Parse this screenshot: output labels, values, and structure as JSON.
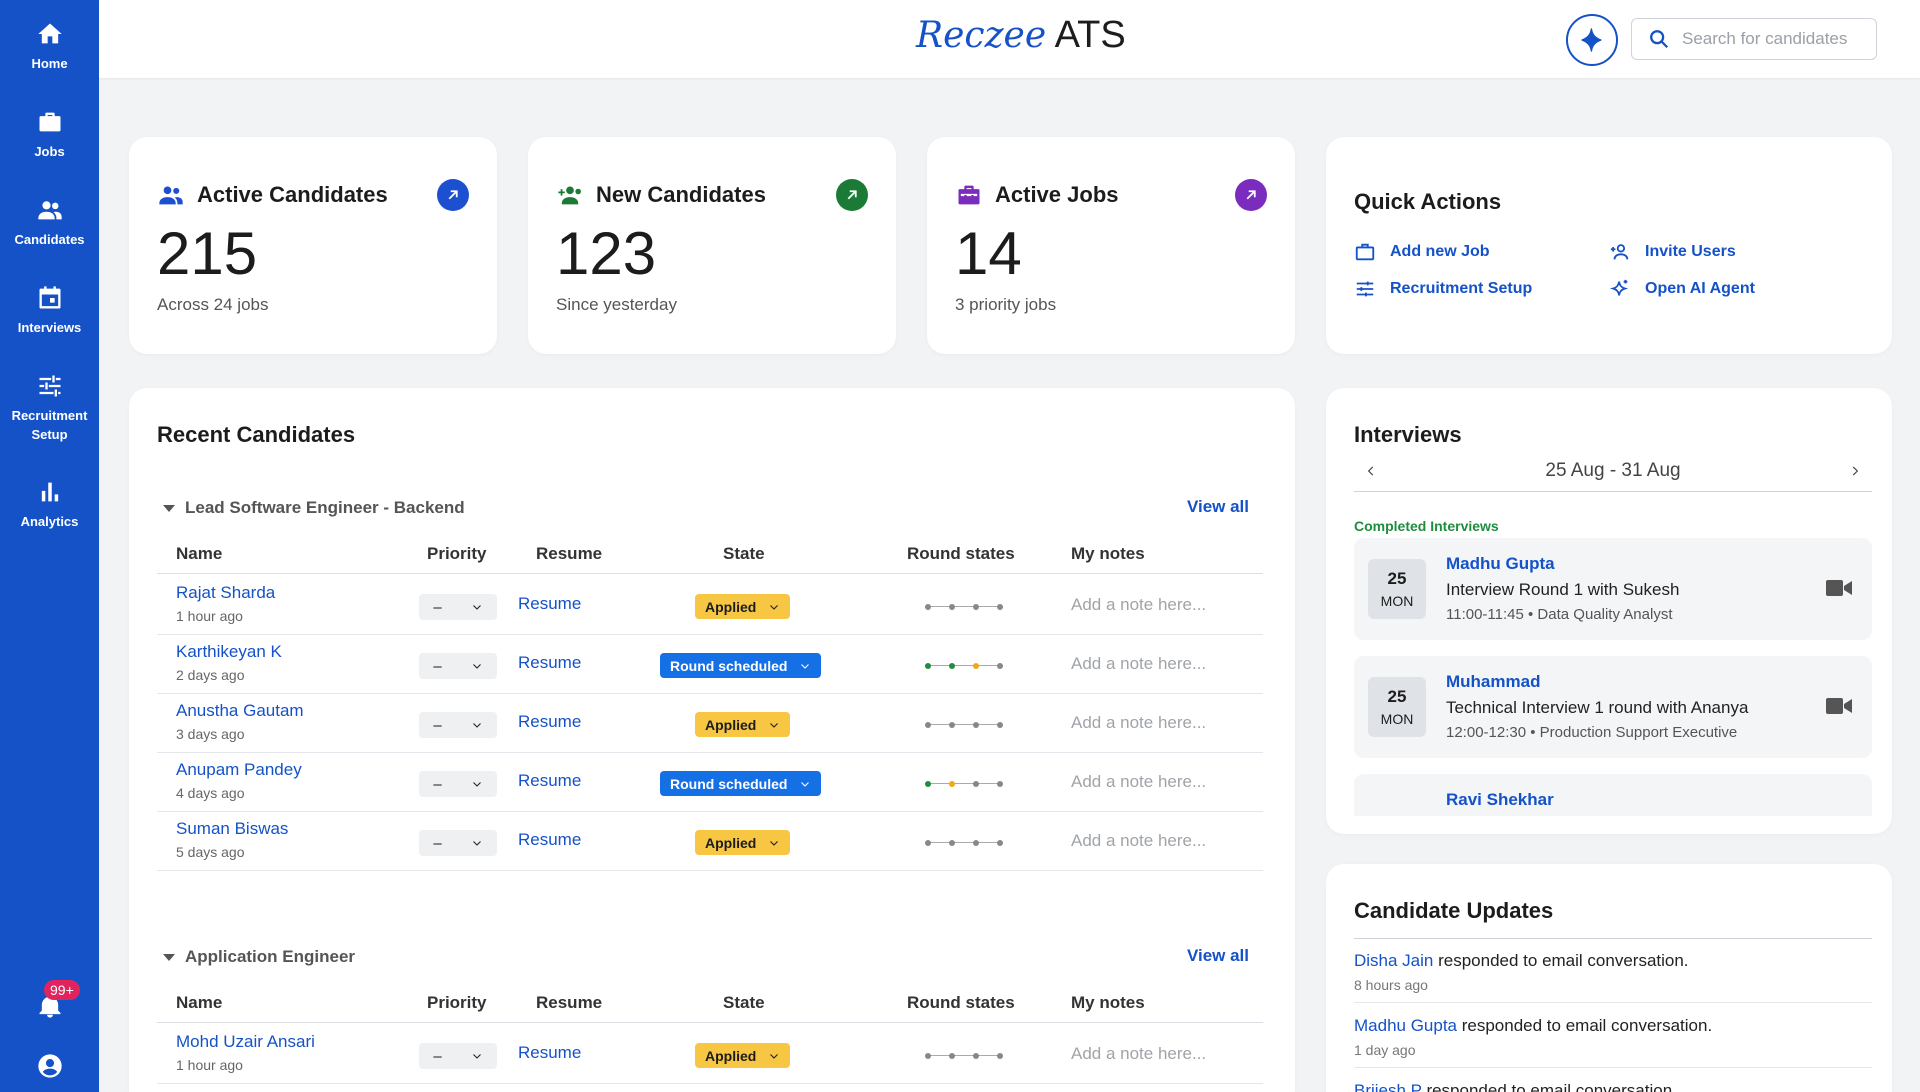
{
  "sidebar": {
    "items": [
      {
        "label": "Home",
        "icon": "home-icon"
      },
      {
        "label": "Jobs",
        "icon": "briefcase-icon"
      },
      {
        "label": "Candidates",
        "icon": "people-icon"
      },
      {
        "label": "Interviews",
        "icon": "calendar-icon"
      },
      {
        "label": "Recruitment Setup",
        "icon": "sliders-icon"
      },
      {
        "label": "Analytics",
        "icon": "bar-chart-icon"
      }
    ],
    "notifications_badge": "99+"
  },
  "header": {
    "logo_brand": "Reczee",
    "logo_product": " ATS",
    "search_placeholder": "Search for candidates"
  },
  "colors": {
    "primary": "#1552c8",
    "active_candidates_accent": "#1d4fd1",
    "new_candidates_accent": "#1b7a35",
    "active_jobs_accent": "#7b2cbf",
    "applied_badge": "#f7c744",
    "round_scheduled_badge": "#1570e6",
    "completed_interviews": "#1e8e3e"
  },
  "stats": {
    "active_candidates": {
      "title": "Active Candidates",
      "value": "215",
      "sub": "Across 24 jobs"
    },
    "new_candidates": {
      "title": "New Candidates",
      "value": "123",
      "sub": "Since yesterday"
    },
    "active_jobs": {
      "title": "Active Jobs",
      "value": "14",
      "sub": "3 priority jobs"
    }
  },
  "quick_actions": {
    "title": "Quick Actions",
    "add_job": "Add new Job",
    "invite_users": "Invite Users",
    "recruitment_setup": "Recruitment Setup",
    "open_ai_agent": "Open AI Agent"
  },
  "recent_candidates": {
    "title": "Recent Candidates",
    "view_all": "View all",
    "columns": {
      "name": "Name",
      "priority": "Priority",
      "resume": "Resume",
      "state": "State",
      "round_states": "Round states",
      "notes": "My notes"
    },
    "priority_value": "–",
    "resume_label": "Resume",
    "note_placeholder": "Add a note here...",
    "groups": [
      {
        "job": "Lead Software Engineer - Backend",
        "rows": [
          {
            "name": "Rajat Sharda",
            "time": "1 hour ago",
            "state": "Applied",
            "rounds": [
              "#888888",
              "#888888",
              "#888888",
              "#888888"
            ]
          },
          {
            "name": "Karthikeyan K",
            "time": "2 days ago",
            "state": "Round scheduled",
            "rounds": [
              "#1e8e3e",
              "#1e8e3e",
              "#f0a818",
              "#888888"
            ]
          },
          {
            "name": "Anustha Gautam",
            "time": "3 days ago",
            "state": "Applied",
            "rounds": [
              "#888888",
              "#888888",
              "#888888",
              "#888888"
            ]
          },
          {
            "name": "Anupam Pandey",
            "time": "4 days ago",
            "state": "Round scheduled",
            "rounds": [
              "#1e8e3e",
              "#f0a818",
              "#888888",
              "#888888"
            ]
          },
          {
            "name": "Suman Biswas",
            "time": "5 days ago",
            "state": "Applied",
            "rounds": [
              "#888888",
              "#888888",
              "#888888",
              "#888888"
            ]
          }
        ]
      },
      {
        "job": "Application Engineer",
        "rows": [
          {
            "name": "Mohd Uzair Ansari",
            "time": "1 hour ago",
            "state": "Applied",
            "rounds": [
              "#888888",
              "#888888",
              "#888888",
              "#888888"
            ]
          }
        ]
      }
    ]
  },
  "interviews": {
    "title": "Interviews",
    "range": "25 Aug - 31 Aug",
    "section": "Completed Interviews",
    "items": [
      {
        "day": "25",
        "weekday": "MON",
        "name": "Madhu Gupta",
        "desc": "Interview Round 1 with Sukesh",
        "meta": "11:00-11:45 • Data Quality Analyst"
      },
      {
        "day": "25",
        "weekday": "MON",
        "name": "Muhammad",
        "desc": "Technical Interview 1 round with Ananya",
        "meta": "12:00-12:30 • Production Support Executive"
      },
      {
        "day": "",
        "weekday": "",
        "name": "Ravi Shekhar",
        "desc": "",
        "meta": ""
      }
    ]
  },
  "candidate_updates": {
    "title": "Candidate Updates",
    "items": [
      {
        "who": "Disha Jain",
        "text": " responded to email conversation.",
        "ago": "8 hours ago"
      },
      {
        "who": "Madhu Gupta",
        "text": " responded to email conversation.",
        "ago": "1 day ago"
      },
      {
        "who": "Brijesh P",
        "text": " responded to email conversation.",
        "ago": ""
      }
    ]
  }
}
